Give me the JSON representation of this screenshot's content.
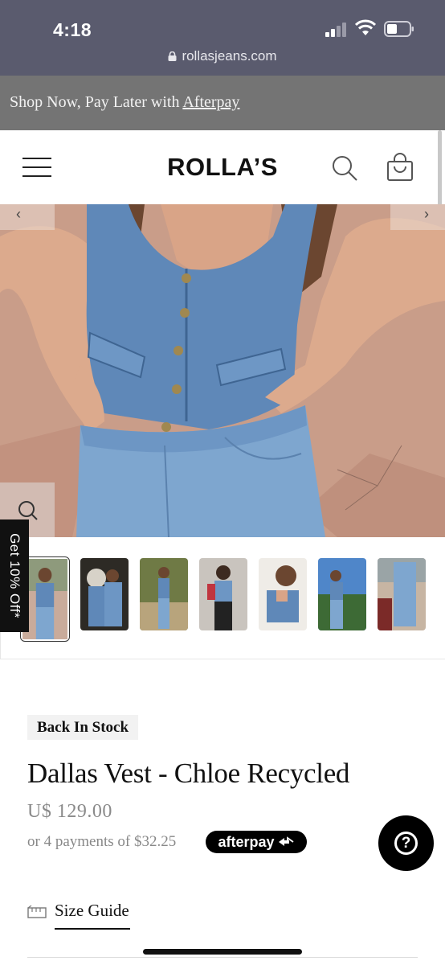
{
  "status_bar": {
    "time": "4:18",
    "url": "rollasjeans.com"
  },
  "promo_banner": {
    "text": "Shop Now, Pay Later with ",
    "link": "Afterpay"
  },
  "header": {
    "logo": "ROLLA’S"
  },
  "gallery": {
    "prev_arrow": "‹",
    "next_arrow": "›",
    "thumbnail_count": 7,
    "active_index": 0
  },
  "discount_tab": {
    "label": "Get 10% Off*"
  },
  "product": {
    "badge": "Back In Stock",
    "title": "Dallas Vest - Chloe Recycled",
    "price": "U$  129.00",
    "installments": "or 4 payments of $32.25",
    "afterpay_label": "afterpay"
  },
  "help": {
    "label": "?"
  },
  "size_guide": {
    "label": "Size Guide"
  },
  "colors": {
    "status_bar": "#5a5b6e",
    "promo_banner": "#747474",
    "denim": "#5f88b8",
    "skin": "#d9a487",
    "ground": "#c79a86"
  }
}
